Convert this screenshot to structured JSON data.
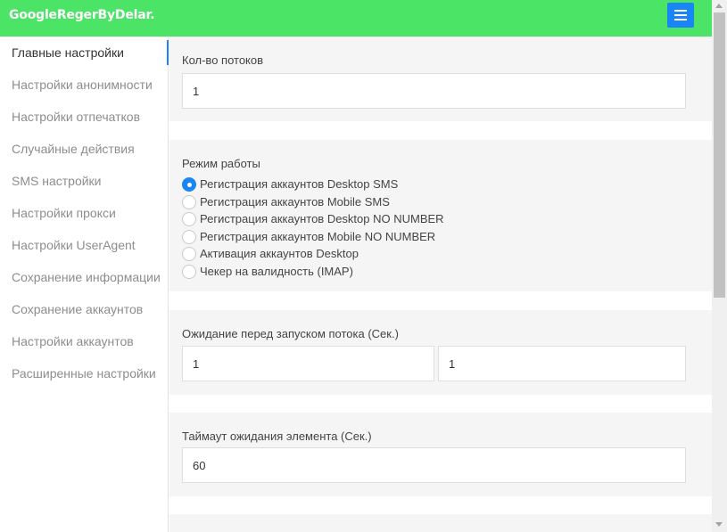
{
  "app": {
    "title": "GoogleRegerByDelar.",
    "menu_icon": "hamburger-icon"
  },
  "sidebar": {
    "items": [
      {
        "label": "Главные настройки",
        "active": true
      },
      {
        "label": "Настройки анонимности"
      },
      {
        "label": "Настройки отпечатков"
      },
      {
        "label": "Случайные действия"
      },
      {
        "label": "SMS настройки"
      },
      {
        "label": "Настройки прокси"
      },
      {
        "label": "Настройки UserAgent"
      },
      {
        "label": "Сохранение информации"
      },
      {
        "label": "Сохранение аккаунтов"
      },
      {
        "label": "Настройки аккаунтов"
      },
      {
        "label": "Расширенные настройки"
      }
    ]
  },
  "threads": {
    "label": "Кол-во потоков",
    "value": "1"
  },
  "mode": {
    "label": "Режим работы",
    "options": [
      {
        "label": "Регистрация аккаунтов Desktop SMS",
        "checked": true
      },
      {
        "label": "Регистрация аккаунтов Mobile SMS"
      },
      {
        "label": "Регистрация аккаунтов Desktop NO NUMBER"
      },
      {
        "label": "Регистрация аккаунтов Mobile NO NUMBER"
      },
      {
        "label": "Активация аккаунтов Desktop"
      },
      {
        "label": "Чекер на валидность (IMAP)"
      }
    ]
  },
  "delay": {
    "label": "Ожидание перед запуском потока (Сек.)",
    "min": "1",
    "max": "1"
  },
  "timeout": {
    "label": "Таймаут ожидания элемента (Сек.)",
    "value": "60"
  },
  "colors": {
    "topbar": "#4be466",
    "accent": "#1a86f5"
  }
}
